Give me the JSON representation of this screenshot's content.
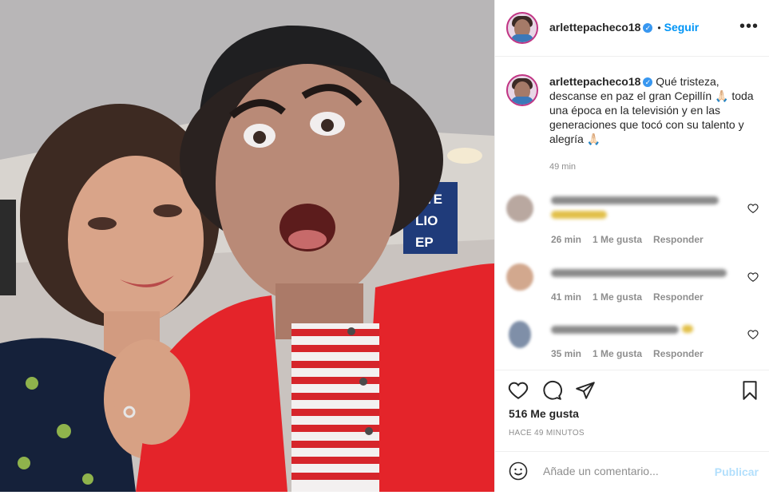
{
  "header": {
    "username": "arlettepacheco18",
    "separator": "•",
    "follow_label": "Seguir",
    "more_icon": "more-horizontal-icon"
  },
  "caption": {
    "username": "arlettepacheco18",
    "text": "Qué tristeza, descanse en paz el gran Cepillín 🙏🏻 toda una época en la televisión y en las generaciones que tocó con su talento y alegría 🙏🏻",
    "time": "49 min"
  },
  "comments": [
    {
      "time": "26 min",
      "likes": "1 Me gusta",
      "reply": "Responder"
    },
    {
      "time": "41 min",
      "likes": "1 Me gusta",
      "reply": "Responder"
    },
    {
      "time": "35 min",
      "likes": "1 Me gusta",
      "reply": "Responder"
    }
  ],
  "actions": {
    "icons": [
      "heart-icon",
      "comment-icon",
      "share-icon",
      "bookmark-icon"
    ]
  },
  "likes_label": "516 Me gusta",
  "posted_ago": "HACE 49 MINUTOS",
  "add_comment": {
    "placeholder": "Añade un comentario...",
    "publish_label": "Publicar"
  },
  "colors": {
    "follow": "#0095f6",
    "publish_disabled": "#b2dffc",
    "verified": "#3897f0",
    "secondary_text": "#8e8e8e"
  },
  "photo": {
    "sign_text": [
      "NTE",
      "LIO",
      "EP"
    ]
  }
}
